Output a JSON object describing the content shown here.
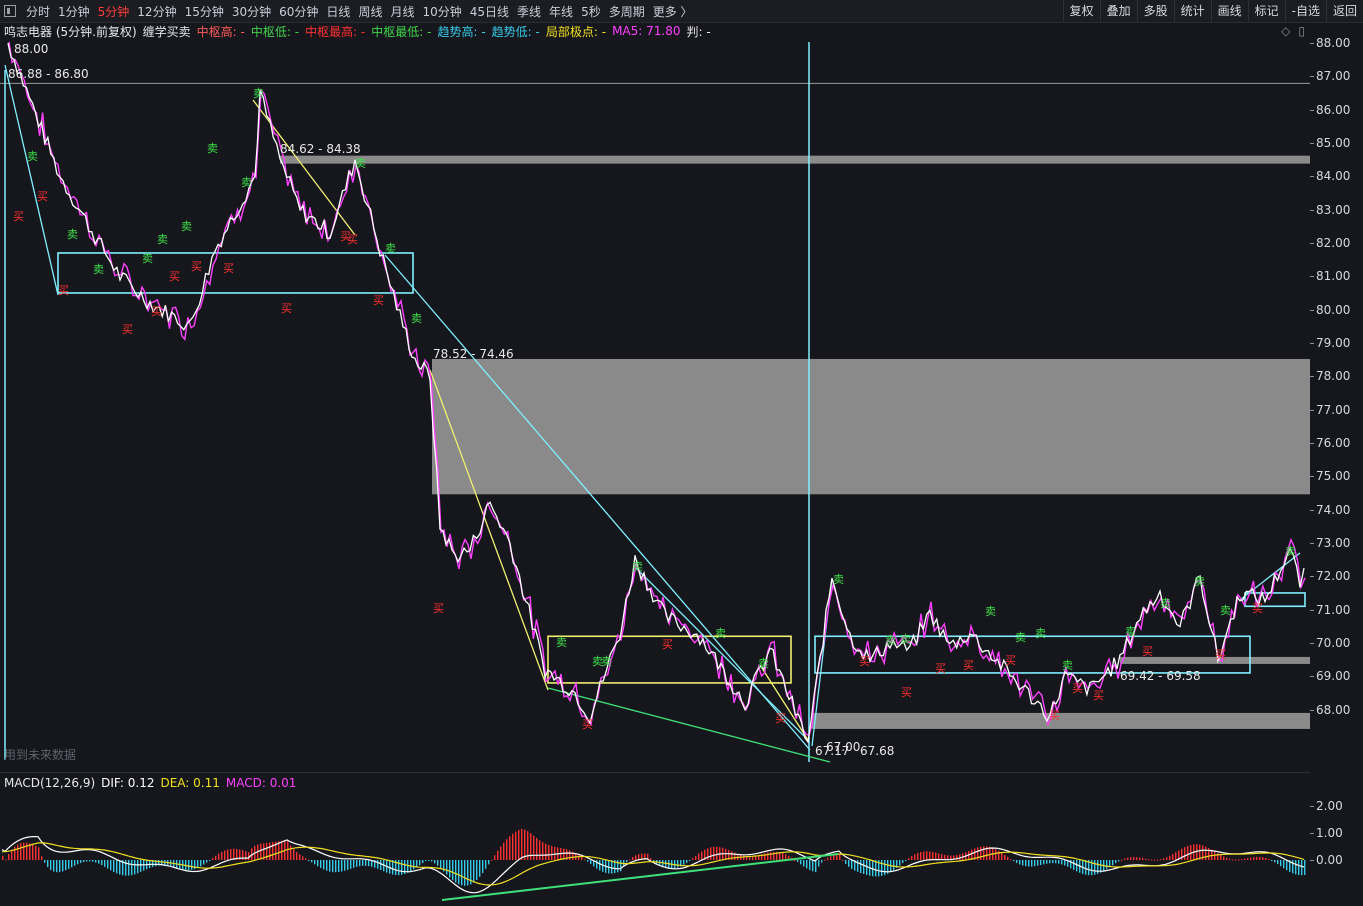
{
  "toolbar": {
    "periods": [
      "分时",
      "1分钟",
      "5分钟",
      "12分钟",
      "15分钟",
      "30分钟",
      "60分钟",
      "日线",
      "周线",
      "月线",
      "10分钟",
      "45日线",
      "季线",
      "年线",
      "5秒",
      "多周期",
      "更多 〉"
    ],
    "active_period": "5分钟",
    "right_buttons": [
      "复权",
      "叠加",
      "多股",
      "统计",
      "画线",
      "标记",
      "-自选",
      "返回"
    ]
  },
  "header": {
    "stock_title": "鸣志电器 (5分钟.前复权)",
    "indicator_name": "缠学买卖",
    "fields": [
      {
        "label": "中枢高: -",
        "color": "#ff5a5a"
      },
      {
        "label": "中枢低: -",
        "color": "#3fd44a"
      },
      {
        "label": "中枢最高: -",
        "color": "#ff3030"
      },
      {
        "label": "中枢最低: -",
        "color": "#3fd44a"
      },
      {
        "label": "趋势高: -",
        "color": "#36c9e8"
      },
      {
        "label": "趋势低: -",
        "color": "#36c9e8"
      },
      {
        "label": "局部极点: -",
        "color": "#f0e020"
      },
      {
        "label": "MA5: 71.80",
        "color": "#ff40ff"
      },
      {
        "label": "判: -",
        "color": "#e8e8e8"
      }
    ],
    "small_icons": [
      "diamond-icon",
      "panel-icon"
    ]
  },
  "watermark": "用到未来数据",
  "price_axis": {
    "ticks": [
      "88.00",
      "87.00",
      "86.00",
      "85.00",
      "84.00",
      "83.00",
      "82.00",
      "81.00",
      "80.00",
      "79.00",
      "78.00",
      "77.00",
      "76.00",
      "75.00",
      "74.00",
      "73.00",
      "72.00",
      "71.00",
      "70.00",
      "69.00",
      "68.00"
    ]
  },
  "annotations": {
    "high_label": "88.00",
    "level_1": "86.88 - 86.80",
    "level_2": "84.62 - 84.38",
    "level_3": "78.52 - 74.46",
    "level_4": "69.42 - 69.58",
    "low_label_a": "67.17",
    "low_label_b": "67.00",
    "low_label_c": "67.68",
    "buy_char": "买",
    "sell_char": "卖"
  },
  "macd": {
    "title": "MACD(12,26,9)",
    "dif": "DIF: 0.12",
    "dea": "DEA: 0.11",
    "macd": "MACD: 0.01",
    "colors": {
      "dif": "#ffffff",
      "dea": "#f0e020",
      "macd": "#ff40ff"
    },
    "axis_ticks": [
      "2.00",
      "1.00",
      "0.00"
    ]
  },
  "chart_data": {
    "type": "line",
    "title": "鸣志电器 (5分钟.前复权)",
    "xlabel": "",
    "ylabel": "",
    "ylim": [
      67.0,
      88.2
    ],
    "key_points": [
      88.0,
      84.0,
      82.2,
      81.0,
      80.2,
      79.5,
      81.8,
      84.0,
      86.5,
      84.5,
      83.0,
      82.3,
      84.5,
      81.8,
      79.8,
      78.5,
      78.0,
      73.5,
      72.6,
      72.8,
      74.2,
      73.0,
      69.2,
      68.5,
      67.8,
      69.5,
      70.3,
      72.5,
      70.8,
      70.2,
      68.2,
      69.8,
      67.0,
      72.0,
      70.2,
      69.5,
      70.0,
      69.8,
      70.9,
      69.9,
      70.3,
      67.8,
      69.0,
      68.6,
      69.5,
      70.8,
      71.5,
      70.5,
      72.0,
      69.5,
      71.5,
      71.3,
      72.8,
      71.8,
      72.2
    ],
    "zones": [
      {
        "label": "86.88 - 86.80",
        "low": 86.8,
        "high": 86.88
      },
      {
        "label": "84.62 - 84.38",
        "low": 84.38,
        "high": 84.62
      },
      {
        "label": "78.52 - 74.46",
        "low": 74.46,
        "high": 78.52
      },
      {
        "label": "69.42 - 69.58",
        "low": 69.42,
        "high": 69.58
      }
    ],
    "centers": [
      {
        "color": "#7ff0ff",
        "low": 80.5,
        "high": 81.7
      },
      {
        "color": "#f0f070",
        "low": 68.8,
        "high": 70.2
      },
      {
        "color": "#7ff0ff",
        "low": 69.1,
        "high": 70.2
      },
      {
        "color": "#7ff0ff",
        "low": 71.1,
        "high": 71.5
      }
    ],
    "macd_ylim": [
      -1.6,
      2.3
    ],
    "macd_ticks": [
      2.0,
      1.0,
      0.0
    ]
  }
}
